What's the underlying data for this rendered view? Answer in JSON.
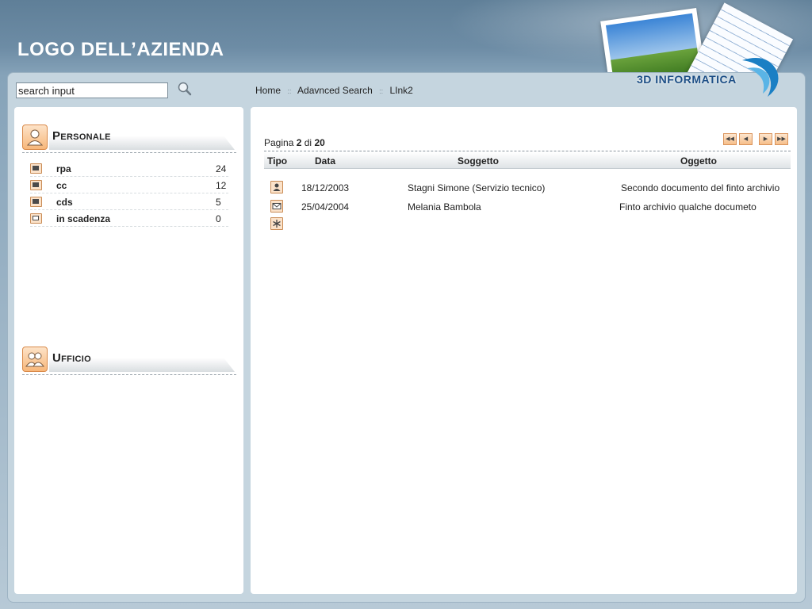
{
  "header": {
    "logo_text": "LOGO DELL’AZIENDA",
    "brand_text": "3D INFORMATICA"
  },
  "toolbar": {
    "search_value": "search input",
    "search_icon": "magnifier-icon",
    "breadcrumb": [
      "Home",
      "Adavnced Search",
      "LInk2"
    ],
    "separator": "::"
  },
  "sidebar": {
    "personale": {
      "title": "Personale",
      "icon": "user-icon",
      "items": [
        {
          "label": "rpa",
          "count": "24",
          "icon": "folder-icon"
        },
        {
          "label": "cc",
          "count": "12",
          "icon": "folder-icon"
        },
        {
          "label": "cds",
          "count": "5",
          "icon": "folder-icon"
        },
        {
          "label": "in scadenza",
          "count": "0",
          "icon": "folder-open-icon"
        }
      ]
    },
    "ufficio": {
      "title": "Ufficio",
      "icon": "group-icon"
    }
  },
  "main": {
    "pager": {
      "prefix": "Pagina",
      "page": "2",
      "of": "di",
      "total": "20"
    },
    "nav_buttons": [
      "first-page",
      "prev-page",
      "next-page",
      "last-page"
    ],
    "columns": [
      "Tipo",
      "Data",
      "Soggetto",
      "Oggetto"
    ],
    "rows": [
      {
        "type_icon": "person-doc-icon",
        "data": "18/12/2003",
        "soggetto": "Stagni Simone (Servizio tecnico)",
        "oggetto": "Secondo documento del finto archivio"
      },
      {
        "type_icon": "mail-icon",
        "data": "25/04/2004",
        "soggetto": "Melania Bambola",
        "oggetto": "Finto archivio qualche documeto"
      },
      {
        "type_icon": "asterisk-icon",
        "data": "",
        "soggetto": "",
        "oggetto": ""
      }
    ]
  },
  "colors": {
    "accent_orange": "#f7b77a",
    "header_blue": "#6d8ca5",
    "brand_blue": "#1d4f86"
  }
}
